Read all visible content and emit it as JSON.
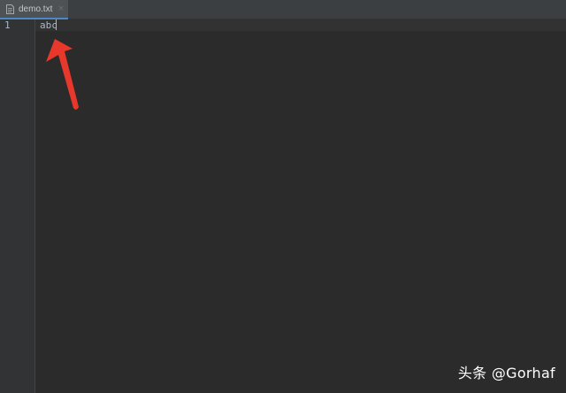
{
  "tab": {
    "filename": "demo.txt",
    "close_glyph": "×"
  },
  "gutter": {
    "line_numbers": [
      "1"
    ]
  },
  "editor": {
    "lines": [
      "abc"
    ]
  },
  "annotation": {
    "arrow_color": "#e8382b",
    "watermark": "头条 @Gorhaf"
  },
  "colors": {
    "editor_bg": "#2b2b2b",
    "tab_accent": "#4a88c7",
    "text": "#a9b7c6"
  }
}
